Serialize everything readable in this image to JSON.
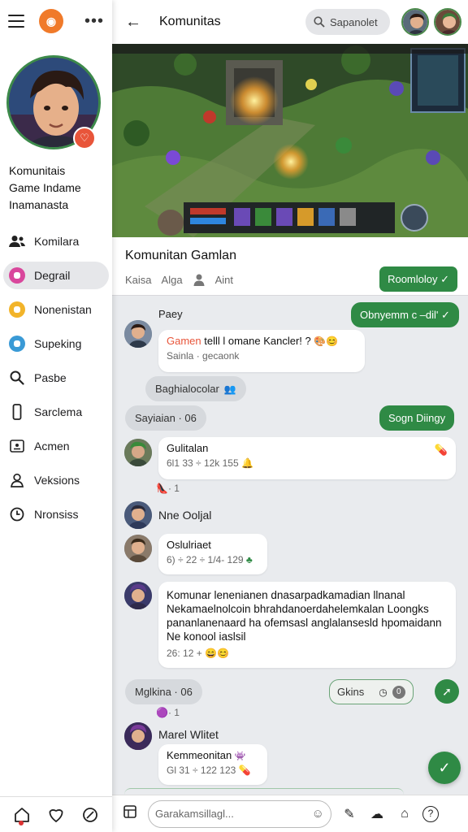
{
  "colors": {
    "accent": "#2f8a45",
    "brand": "#f07a2a",
    "badge": "#e8553a"
  },
  "drawer": {
    "community_name": [
      "Komunitais",
      "Game Indame",
      "Inamanasta"
    ],
    "menu": [
      {
        "label": "Komilara",
        "icon": "people-icon"
      },
      {
        "label": "Degrail",
        "icon": "pink-chat-icon"
      },
      {
        "label": "Nonenistan",
        "icon": "yellow-lock-icon"
      },
      {
        "label": "Supeking",
        "icon": "blue-lock-icon"
      },
      {
        "label": "Pasbe",
        "icon": "search-icon"
      },
      {
        "label": "Sarclema",
        "icon": "phone-icon"
      },
      {
        "label": "Acmen",
        "icon": "id-card-icon"
      },
      {
        "label": "Veksions",
        "icon": "person-icon"
      },
      {
        "label": "Nronsiss",
        "icon": "clock-icon"
      }
    ]
  },
  "header": {
    "title": "Komunitas",
    "search_placeholder": "Sapanolet"
  },
  "banner": {
    "title": "Komunitan Gamlan",
    "meta": [
      "Kaisa",
      "Alga",
      "Aint"
    ],
    "join_label": "Roomloloy ✓"
  },
  "chat": {
    "top_green_pill": "Obnyemm c –dil' ✓",
    "msg1": {
      "sender": "Paey",
      "text_accent": "Gamen",
      "text": " telll l omane Kancler! ?",
      "meta": "Sainla · gecaonk"
    },
    "pill1": "Baghialocolar",
    "day1": "Sayiaian · 06",
    "green2": "Sogn Diingy",
    "msg2": {
      "title": "Gulitalan",
      "meta": "6l1 33 ÷ 12k 155"
    },
    "reaction2": "· 1",
    "sender3": "Nne Ooljal",
    "msg3": {
      "title": "Oslulriaet",
      "meta": "6) ÷ 22 ÷ 1/4- 129"
    },
    "msg4": {
      "lines": [
        "Komunar lenenianen dnasarpadkamadian llnanal",
        "Nekamaelnolcoin bhrahdanoerdahelemkalan Loongks",
        "pananlanenaard ha ofemsasl anglalansesld hpomaidann",
        "Ne konool iaslsil"
      ],
      "meta": "26: 12 +"
    },
    "day2": "Mglkina · 06",
    "outline_pill": "Gkins",
    "reaction5": "· 1",
    "sender5": "Marel Wlitet",
    "msg5": {
      "title": "Kemmeonitan",
      "meta": "Gl 31 ÷ 122 123"
    }
  },
  "composer": {
    "placeholder": "Garakamsillagl..."
  }
}
